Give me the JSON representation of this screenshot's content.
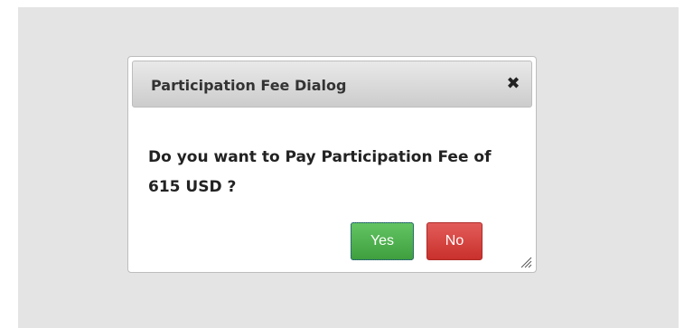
{
  "dialog": {
    "title": "Participation Fee Dialog",
    "close_symbol": "✖",
    "message": "Do you want to Pay Participation Fee of 615 USD ?",
    "yes_label": "Yes",
    "no_label": "No"
  },
  "icons": {
    "close": "close-icon",
    "resize": "resize-grip-icon"
  },
  "colors": {
    "backdrop": "#e4e4e4",
    "yes_button": "#4cae4c",
    "no_button": "#d9534f",
    "title_text": "#333333"
  }
}
